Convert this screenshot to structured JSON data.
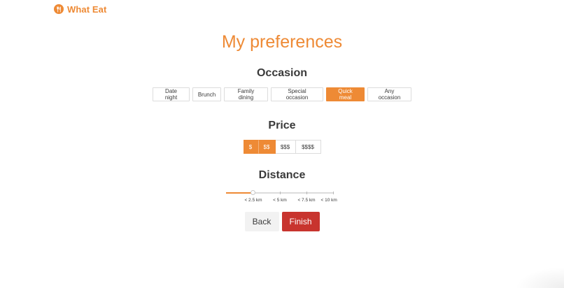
{
  "brand": {
    "name": "What Eat",
    "icon": "utensils-icon",
    "color": "#ee8a35"
  },
  "page": {
    "title": "My preferences"
  },
  "occasion": {
    "title": "Occasion",
    "options": [
      {
        "label": "Date night",
        "selected": false
      },
      {
        "label": "Brunch",
        "selected": false
      },
      {
        "label": "Family dining",
        "selected": false
      },
      {
        "label": "Special occasion",
        "selected": false
      },
      {
        "label": "Quick meal",
        "selected": true
      },
      {
        "label": "Any occasion",
        "selected": false
      }
    ]
  },
  "price": {
    "title": "Price",
    "options": [
      {
        "label": "$",
        "selected": true
      },
      {
        "label": "$$",
        "selected": true
      },
      {
        "label": "$$$",
        "selected": false
      },
      {
        "label": "$$$$",
        "selected": false
      }
    ]
  },
  "distance": {
    "title": "Distance",
    "marks": [
      "< 2.5 km",
      "< 5 km",
      "< 7.5 km",
      "< 10 km"
    ],
    "selected_index": 0,
    "selected_label": "< 2.5 km"
  },
  "actions": {
    "back_label": "Back",
    "finish_label": "Finish"
  },
  "colors": {
    "accent": "#ee8a35",
    "finish": "#c8342e",
    "back": "#f2f2f2"
  }
}
